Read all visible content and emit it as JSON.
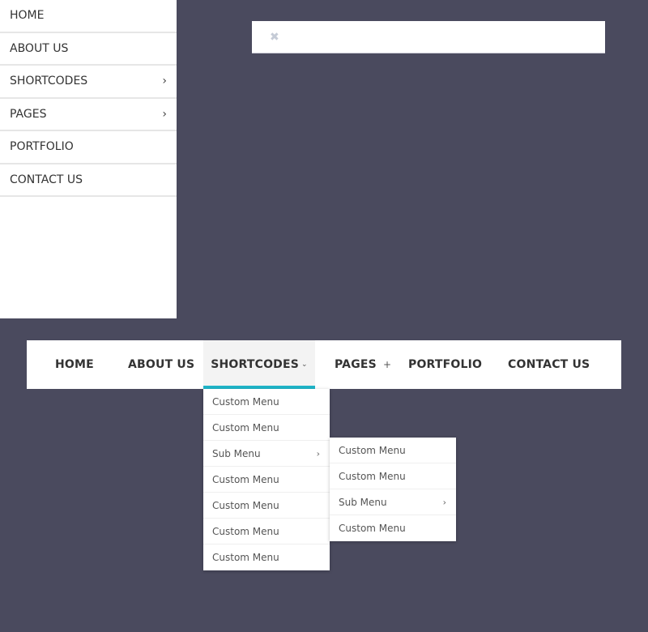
{
  "sidebar": {
    "items": [
      {
        "label": "HOME",
        "has_submenu": false
      },
      {
        "label": "ABOUT US",
        "has_submenu": false
      },
      {
        "label": "SHORTCODES",
        "has_submenu": true,
        "chevron": "›"
      },
      {
        "label": "PAGES",
        "has_submenu": true,
        "chevron": "›"
      },
      {
        "label": "PORTFOLIO",
        "has_submenu": false
      },
      {
        "label": "CONTACT US",
        "has_submenu": false
      }
    ]
  },
  "search_bar": {
    "close_icon": "✖"
  },
  "navbar": {
    "accent_color": "#1fb5c9",
    "items": [
      {
        "label": "HOME"
      },
      {
        "label": "ABOUT US"
      },
      {
        "label": "SHORTCODES",
        "active": true,
        "indicator": "⌄"
      },
      {
        "label": "PAGES",
        "indicator": "+"
      },
      {
        "label": "PORTFOLIO"
      },
      {
        "label": "CONTACT US"
      }
    ]
  },
  "dropdown": {
    "items": [
      {
        "label": "Custom Menu"
      },
      {
        "label": "Custom Menu"
      },
      {
        "label": "Sub Menu",
        "chevron": "›"
      },
      {
        "label": "Custom Menu"
      },
      {
        "label": "Custom Menu"
      },
      {
        "label": "Custom Menu"
      },
      {
        "label": "Custom Menu"
      }
    ]
  },
  "submenu": {
    "items": [
      {
        "label": "Custom Menu"
      },
      {
        "label": "Custom Menu"
      },
      {
        "label": "Sub Menu",
        "chevron": "›"
      },
      {
        "label": "Custom Menu"
      }
    ]
  }
}
